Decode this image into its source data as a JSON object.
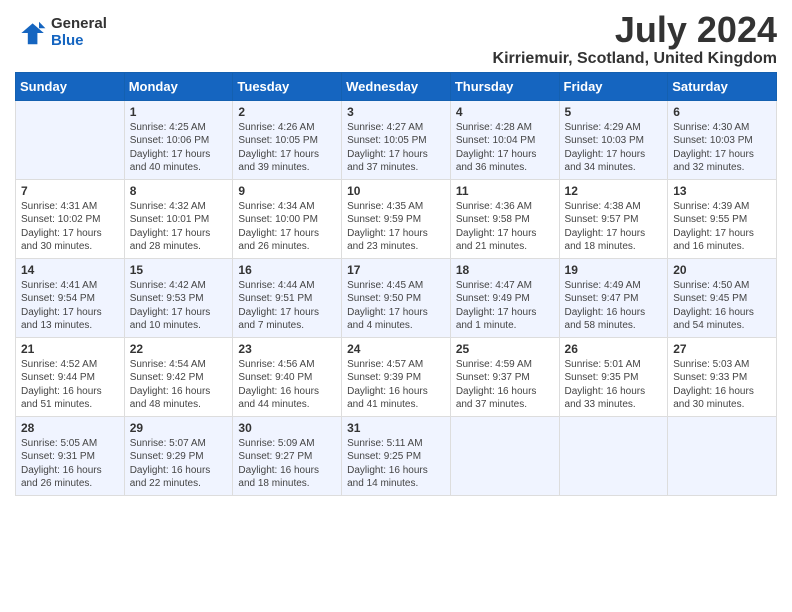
{
  "header": {
    "logo_general": "General",
    "logo_blue": "Blue",
    "month_year": "July 2024",
    "location": "Kirriemuir, Scotland, United Kingdom"
  },
  "days_of_week": [
    "Sunday",
    "Monday",
    "Tuesday",
    "Wednesday",
    "Thursday",
    "Friday",
    "Saturday"
  ],
  "weeks": [
    [
      {
        "day": "",
        "content": ""
      },
      {
        "day": "1",
        "content": "Sunrise: 4:25 AM\nSunset: 10:06 PM\nDaylight: 17 hours\nand 40 minutes."
      },
      {
        "day": "2",
        "content": "Sunrise: 4:26 AM\nSunset: 10:05 PM\nDaylight: 17 hours\nand 39 minutes."
      },
      {
        "day": "3",
        "content": "Sunrise: 4:27 AM\nSunset: 10:05 PM\nDaylight: 17 hours\nand 37 minutes."
      },
      {
        "day": "4",
        "content": "Sunrise: 4:28 AM\nSunset: 10:04 PM\nDaylight: 17 hours\nand 36 minutes."
      },
      {
        "day": "5",
        "content": "Sunrise: 4:29 AM\nSunset: 10:03 PM\nDaylight: 17 hours\nand 34 minutes."
      },
      {
        "day": "6",
        "content": "Sunrise: 4:30 AM\nSunset: 10:03 PM\nDaylight: 17 hours\nand 32 minutes."
      }
    ],
    [
      {
        "day": "7",
        "content": "Sunrise: 4:31 AM\nSunset: 10:02 PM\nDaylight: 17 hours\nand 30 minutes."
      },
      {
        "day": "8",
        "content": "Sunrise: 4:32 AM\nSunset: 10:01 PM\nDaylight: 17 hours\nand 28 minutes."
      },
      {
        "day": "9",
        "content": "Sunrise: 4:34 AM\nSunset: 10:00 PM\nDaylight: 17 hours\nand 26 minutes."
      },
      {
        "day": "10",
        "content": "Sunrise: 4:35 AM\nSunset: 9:59 PM\nDaylight: 17 hours\nand 23 minutes."
      },
      {
        "day": "11",
        "content": "Sunrise: 4:36 AM\nSunset: 9:58 PM\nDaylight: 17 hours\nand 21 minutes."
      },
      {
        "day": "12",
        "content": "Sunrise: 4:38 AM\nSunset: 9:57 PM\nDaylight: 17 hours\nand 18 minutes."
      },
      {
        "day": "13",
        "content": "Sunrise: 4:39 AM\nSunset: 9:55 PM\nDaylight: 17 hours\nand 16 minutes."
      }
    ],
    [
      {
        "day": "14",
        "content": "Sunrise: 4:41 AM\nSunset: 9:54 PM\nDaylight: 17 hours\nand 13 minutes."
      },
      {
        "day": "15",
        "content": "Sunrise: 4:42 AM\nSunset: 9:53 PM\nDaylight: 17 hours\nand 10 minutes."
      },
      {
        "day": "16",
        "content": "Sunrise: 4:44 AM\nSunset: 9:51 PM\nDaylight: 17 hours\nand 7 minutes."
      },
      {
        "day": "17",
        "content": "Sunrise: 4:45 AM\nSunset: 9:50 PM\nDaylight: 17 hours\nand 4 minutes."
      },
      {
        "day": "18",
        "content": "Sunrise: 4:47 AM\nSunset: 9:49 PM\nDaylight: 17 hours\nand 1 minute."
      },
      {
        "day": "19",
        "content": "Sunrise: 4:49 AM\nSunset: 9:47 PM\nDaylight: 16 hours\nand 58 minutes."
      },
      {
        "day": "20",
        "content": "Sunrise: 4:50 AM\nSunset: 9:45 PM\nDaylight: 16 hours\nand 54 minutes."
      }
    ],
    [
      {
        "day": "21",
        "content": "Sunrise: 4:52 AM\nSunset: 9:44 PM\nDaylight: 16 hours\nand 51 minutes."
      },
      {
        "day": "22",
        "content": "Sunrise: 4:54 AM\nSunset: 9:42 PM\nDaylight: 16 hours\nand 48 minutes."
      },
      {
        "day": "23",
        "content": "Sunrise: 4:56 AM\nSunset: 9:40 PM\nDaylight: 16 hours\nand 44 minutes."
      },
      {
        "day": "24",
        "content": "Sunrise: 4:57 AM\nSunset: 9:39 PM\nDaylight: 16 hours\nand 41 minutes."
      },
      {
        "day": "25",
        "content": "Sunrise: 4:59 AM\nSunset: 9:37 PM\nDaylight: 16 hours\nand 37 minutes."
      },
      {
        "day": "26",
        "content": "Sunrise: 5:01 AM\nSunset: 9:35 PM\nDaylight: 16 hours\nand 33 minutes."
      },
      {
        "day": "27",
        "content": "Sunrise: 5:03 AM\nSunset: 9:33 PM\nDaylight: 16 hours\nand 30 minutes."
      }
    ],
    [
      {
        "day": "28",
        "content": "Sunrise: 5:05 AM\nSunset: 9:31 PM\nDaylight: 16 hours\nand 26 minutes."
      },
      {
        "day": "29",
        "content": "Sunrise: 5:07 AM\nSunset: 9:29 PM\nDaylight: 16 hours\nand 22 minutes."
      },
      {
        "day": "30",
        "content": "Sunrise: 5:09 AM\nSunset: 9:27 PM\nDaylight: 16 hours\nand 18 minutes."
      },
      {
        "day": "31",
        "content": "Sunrise: 5:11 AM\nSunset: 9:25 PM\nDaylight: 16 hours\nand 14 minutes."
      },
      {
        "day": "",
        "content": ""
      },
      {
        "day": "",
        "content": ""
      },
      {
        "day": "",
        "content": ""
      }
    ]
  ]
}
